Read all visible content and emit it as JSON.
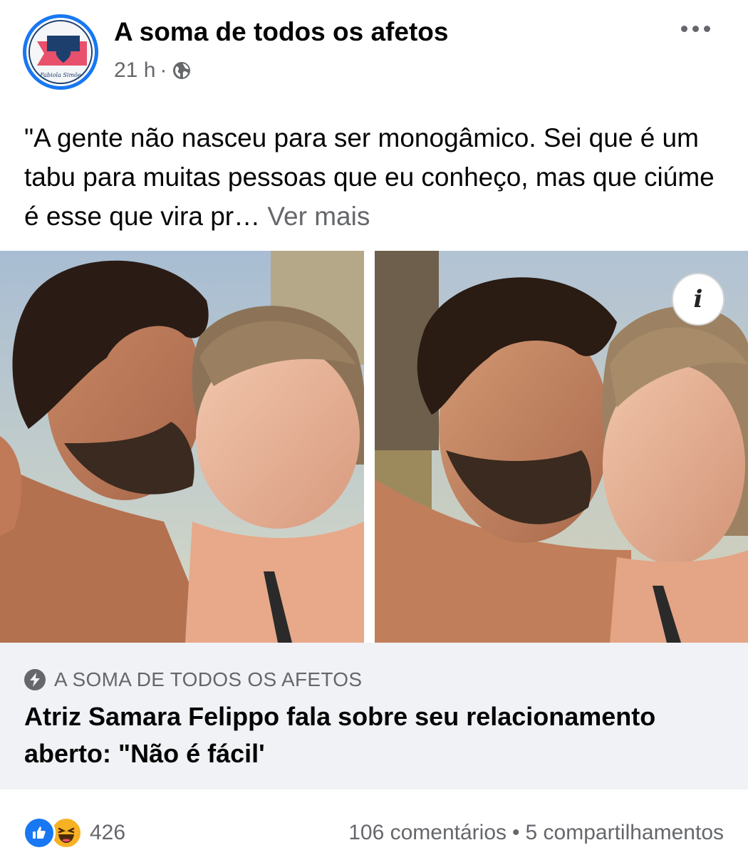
{
  "post": {
    "page_name": "A soma de todos os afetos",
    "time": "21 h",
    "separator": "·",
    "privacy_icon": "globe-icon",
    "more_icon": "more-horizontal-icon",
    "text": "\"A gente não nasceu para ser monogâmico. Sei que é um tabu para muitas pessoas que eu conheço, mas que ciúme é esse que vira pr…",
    "see_more": " Ver mais",
    "avatar_text": "Fabiola Simões"
  },
  "link": {
    "source": "A SOMA DE TODOS OS AFETOS",
    "title": "Atriz Samara Felippo fala sobre seu relacionamento aberto: \"Não é fácil'",
    "info_icon": "i"
  },
  "reactions": {
    "count": "426",
    "comments": "106 comentários",
    "dot": "•",
    "shares": "5 compartilhamentos"
  },
  "colors": {
    "accent": "#1877f2",
    "secondary_text": "#65676b",
    "link_bg": "#f0f2f5",
    "haha": "#f7b125"
  }
}
